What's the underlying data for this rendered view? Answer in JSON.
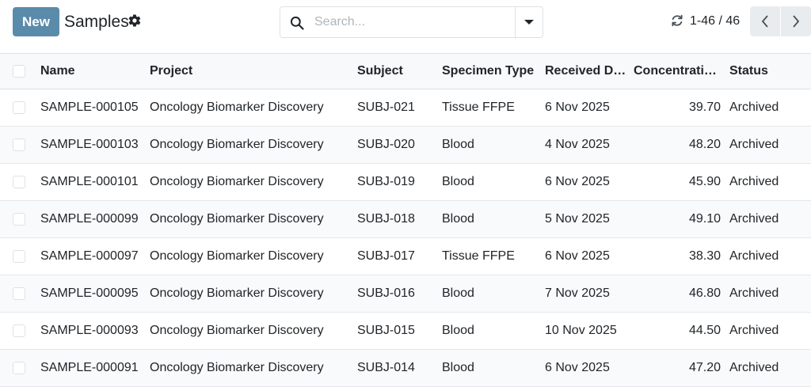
{
  "control_panel": {
    "new_label": "New",
    "title": "Samples",
    "search_placeholder": "Search...",
    "pager": "1-46 / 46"
  },
  "table": {
    "columns": [
      "Name",
      "Project",
      "Subject",
      "Specimen Type",
      "Received D…",
      "Concentrati…",
      "Status"
    ],
    "rows": [
      {
        "name": "SAMPLE-000105",
        "project": "Oncology Biomarker Discovery",
        "subject": "SUBJ-021",
        "specimen": "Tissue FFPE",
        "received": "6 Nov 2025",
        "concentration": "39.70",
        "status": "Archived"
      },
      {
        "name": "SAMPLE-000103",
        "project": "Oncology Biomarker Discovery",
        "subject": "SUBJ-020",
        "specimen": "Blood",
        "received": "4 Nov 2025",
        "concentration": "48.20",
        "status": "Archived"
      },
      {
        "name": "SAMPLE-000101",
        "project": "Oncology Biomarker Discovery",
        "subject": "SUBJ-019",
        "specimen": "Blood",
        "received": "6 Nov 2025",
        "concentration": "45.90",
        "status": "Archived"
      },
      {
        "name": "SAMPLE-000099",
        "project": "Oncology Biomarker Discovery",
        "subject": "SUBJ-018",
        "specimen": "Blood",
        "received": "5 Nov 2025",
        "concentration": "49.10",
        "status": "Archived"
      },
      {
        "name": "SAMPLE-000097",
        "project": "Oncology Biomarker Discovery",
        "subject": "SUBJ-017",
        "specimen": "Tissue FFPE",
        "received": "6 Nov 2025",
        "concentration": "38.30",
        "status": "Archived"
      },
      {
        "name": "SAMPLE-000095",
        "project": "Oncology Biomarker Discovery",
        "subject": "SUBJ-016",
        "specimen": "Blood",
        "received": "7 Nov 2025",
        "concentration": "46.80",
        "status": "Archived"
      },
      {
        "name": "SAMPLE-000093",
        "project": "Oncology Biomarker Discovery",
        "subject": "SUBJ-015",
        "specimen": "Blood",
        "received": "10 Nov 2025",
        "concentration": "44.50",
        "status": "Archived"
      },
      {
        "name": "SAMPLE-000091",
        "project": "Oncology Biomarker Discovery",
        "subject": "SUBJ-014",
        "specimen": "Blood",
        "received": "6 Nov 2025",
        "concentration": "47.20",
        "status": "Archived"
      }
    ]
  },
  "colors": {
    "primary": "#5b8bab",
    "header_bg": "#f8f9fa",
    "border": "#dee2e6"
  },
  "icons": {
    "settings": "gear-icon",
    "search": "search-icon",
    "dropdown": "caret-down-icon",
    "refresh": "refresh-icon",
    "prev": "chevron-left-icon",
    "next": "chevron-right-icon"
  }
}
